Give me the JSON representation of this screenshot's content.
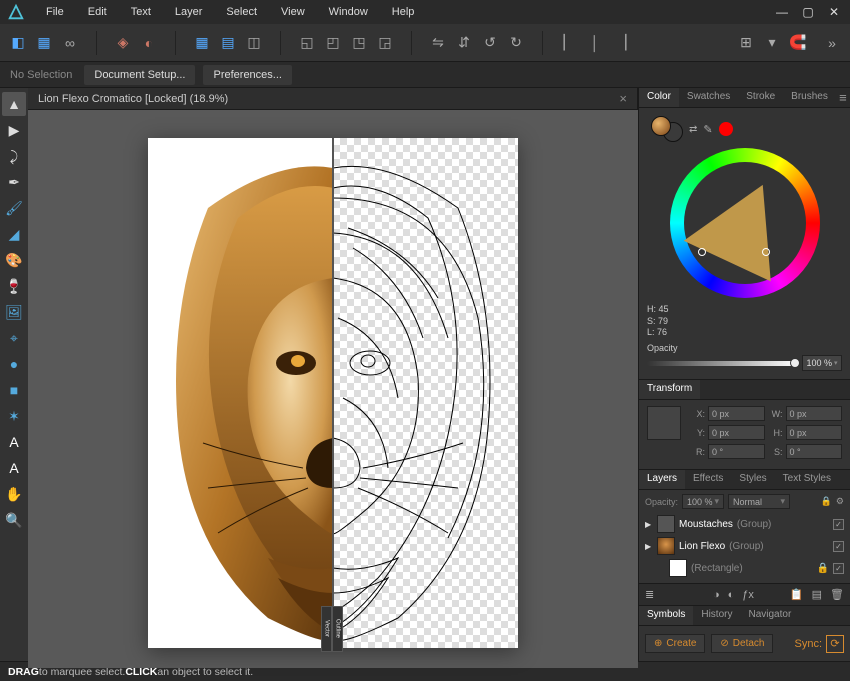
{
  "menubar": {
    "items": [
      "File",
      "Edit",
      "Text",
      "Layer",
      "Select",
      "View",
      "Window",
      "Help"
    ]
  },
  "contextbar": {
    "selection": "No Selection",
    "buttons": [
      "Document Setup...",
      "Preferences..."
    ]
  },
  "document": {
    "tab_title": "Lion Flexo Cromatico [Locked] (18.9%)"
  },
  "split_view": {
    "left_mode": "Vector",
    "right_mode": "Outline"
  },
  "color_panel": {
    "tabs": [
      "Color",
      "Swatches",
      "Stroke",
      "Brushes"
    ],
    "active_tab": "Color",
    "well_color": "#c58a3f",
    "secondary_chip": "#ff0000",
    "hsl": {
      "h_label": "H:",
      "h": "45",
      "s_label": "S:",
      "s": "79",
      "l_label": "L:",
      "l": "76"
    },
    "opacity_label": "Opacity",
    "opacity_value": "100 %"
  },
  "transform": {
    "header": "Transform",
    "x_label": "X:",
    "x": "0 px",
    "y_label": "Y:",
    "y": "0 px",
    "w_label": "W:",
    "w": "0 px",
    "h_label": "H:",
    "h": "0 px",
    "r_label": "R:",
    "r": "0 °",
    "s_label": "S:",
    "s": "0 °"
  },
  "layers_panel": {
    "tabs": [
      "Layers",
      "Effects",
      "Styles",
      "Text Styles"
    ],
    "active_tab": "Layers",
    "opacity_label": "Opacity:",
    "opacity_value": "100 %",
    "blend_mode": "Normal",
    "layers": [
      {
        "name": "Moustaches",
        "group": "(Group)",
        "has_children": true,
        "thumb": "dark",
        "locked": false,
        "visible": true
      },
      {
        "name": "Lion Flexo",
        "group": "(Group)",
        "has_children": true,
        "thumb": "lion",
        "locked": false,
        "visible": true
      },
      {
        "name": "(Rectangle)",
        "group": "",
        "has_children": false,
        "thumb": "white",
        "locked": true,
        "visible": true
      }
    ],
    "footer_fx": "ƒx"
  },
  "symbols_panel": {
    "tabs": [
      "Symbols",
      "History",
      "Navigator"
    ],
    "active_tab": "Symbols",
    "create": "Create",
    "detach": "Detach",
    "sync_label": "Sync:"
  },
  "statusbar": {
    "drag": "DRAG",
    "t1": " to marquee select. ",
    "click": "CLICK",
    "t2": " an object to select it."
  },
  "tools": {
    "list": [
      "move-tool",
      "node-tool",
      "corner-tool",
      "pen-tool",
      "brush-tool",
      "fill-tool",
      "gradient-tool",
      "transparency-tool",
      "place-tool",
      "crop-tool",
      "shape-ellipse-tool",
      "shape-rect-tool",
      "shape-star-tool",
      "text-tool",
      "frame-text-tool",
      "pan-tool",
      "zoom-tool"
    ]
  }
}
